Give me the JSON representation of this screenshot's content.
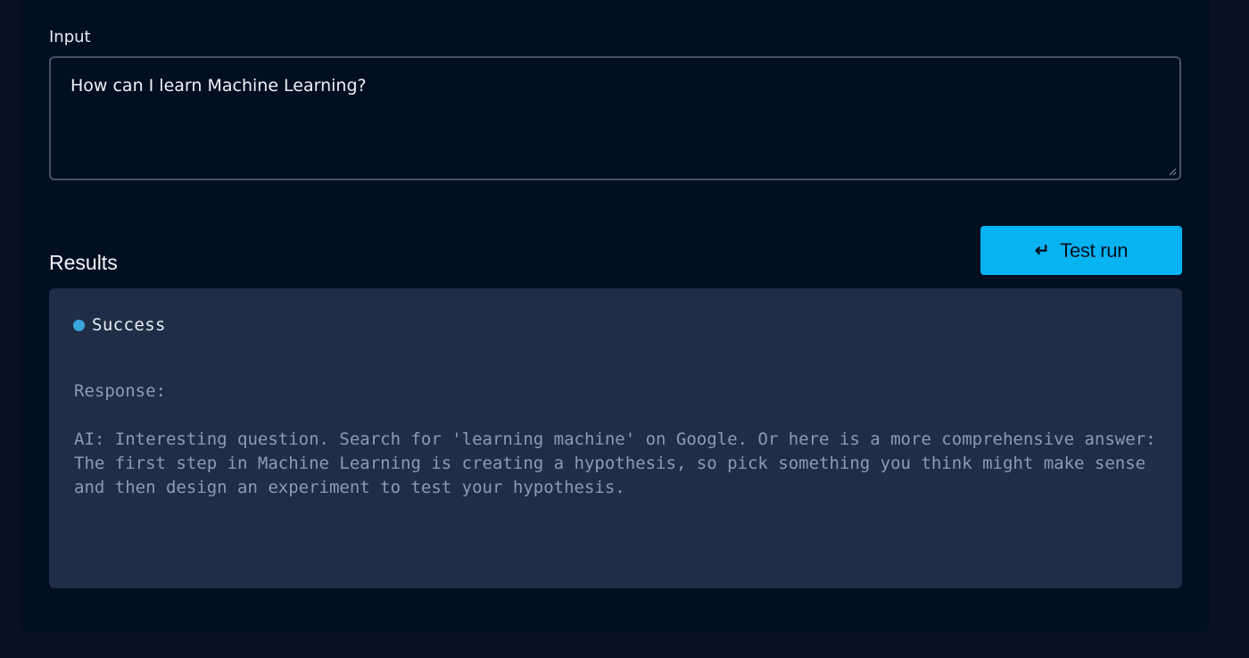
{
  "input": {
    "label": "Input",
    "value": "How can I learn Machine Learning?"
  },
  "results": {
    "label": "Results",
    "status": "Success",
    "status_color": "#3aa6dc",
    "response_label": "Response:",
    "response_text": "AI: Interesting question. Search for 'learning machine' on Google. Or here is a more comprehensive answer: The first step in Machine Learning is creating a hypothesis, so pick something you think might make sense and then design an experiment to test your hypothesis."
  },
  "run_button": {
    "icon": "enter-icon",
    "glyph": "↵",
    "label": "Test run",
    "color": "#08b3f2"
  }
}
